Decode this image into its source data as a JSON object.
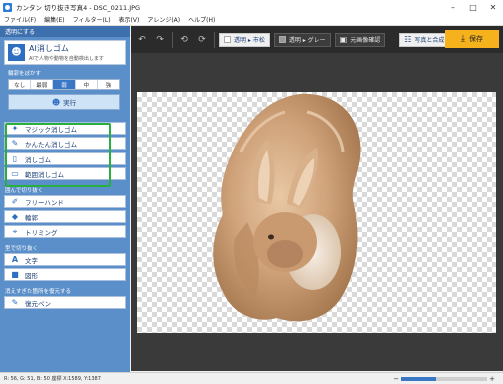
{
  "window": {
    "title": "カンタン 切り抜き写真4 - DSC_0211.JPG",
    "minimize": "–",
    "maximize": "□",
    "close": "✕"
  },
  "menu": [
    "ファイル(F)",
    "編集(E)",
    "フィルター(L)",
    "表示(V)",
    "アレンジ(A)",
    "ヘルプ(H)"
  ],
  "left_panel": {
    "transparent_header": "透明にする",
    "ai_eraser": {
      "icon": "person-icon",
      "title": "AI消しゴム",
      "description": "AIで人物や動物を自動検出します"
    },
    "blur_label": "輪郭をぼかす",
    "blur_options": [
      "なし",
      "最弱",
      "弱",
      "中",
      "強"
    ],
    "blur_selected": "弱",
    "run_label": "実行",
    "eraser_tools": [
      {
        "icon": "magic-wand-icon",
        "label": "マジック消しゴム"
      },
      {
        "icon": "easy-eraser-icon",
        "label": "かんたん消しゴム"
      },
      {
        "icon": "eraser-icon",
        "label": "消しゴム"
      },
      {
        "icon": "rect-eraser-icon",
        "label": "範囲消しゴム"
      }
    ],
    "surround_header": "囲んで切り抜く",
    "surround_tools": [
      {
        "icon": "freehand-icon",
        "label": "フリーハンド"
      },
      {
        "icon": "outline-icon",
        "label": "輪郭"
      },
      {
        "icon": "trim-icon",
        "label": "トリミング"
      }
    ],
    "shape_header": "型で切り抜く",
    "shape_tools": [
      {
        "icon": "text-icon",
        "label": "文字"
      },
      {
        "icon": "shape-icon",
        "label": "図形"
      }
    ],
    "restore_header": "消えすぎた箇所を復元する",
    "restore_tools": [
      {
        "icon": "restore-pen-icon",
        "label": "復元ペン"
      }
    ]
  },
  "toolbar": {
    "transparent_checker": "透明 ▸ 市松",
    "transparent_gray": "透明 ▸ グレー",
    "original_view": "元画像確認",
    "photo_compose": "写真と合成",
    "save": "保存"
  },
  "status": {
    "text": "R: 56, G: 51, B: 50  座標 X:1589, Y:1387"
  },
  "zoom": {
    "minus": "−",
    "plus": "+",
    "level": 0.4
  },
  "colors": {
    "panel_blue": "#5b8fc9",
    "accent": "#2e6fc2",
    "save_yellow": "#f5b21d",
    "highlight_green": "#27b03f"
  }
}
